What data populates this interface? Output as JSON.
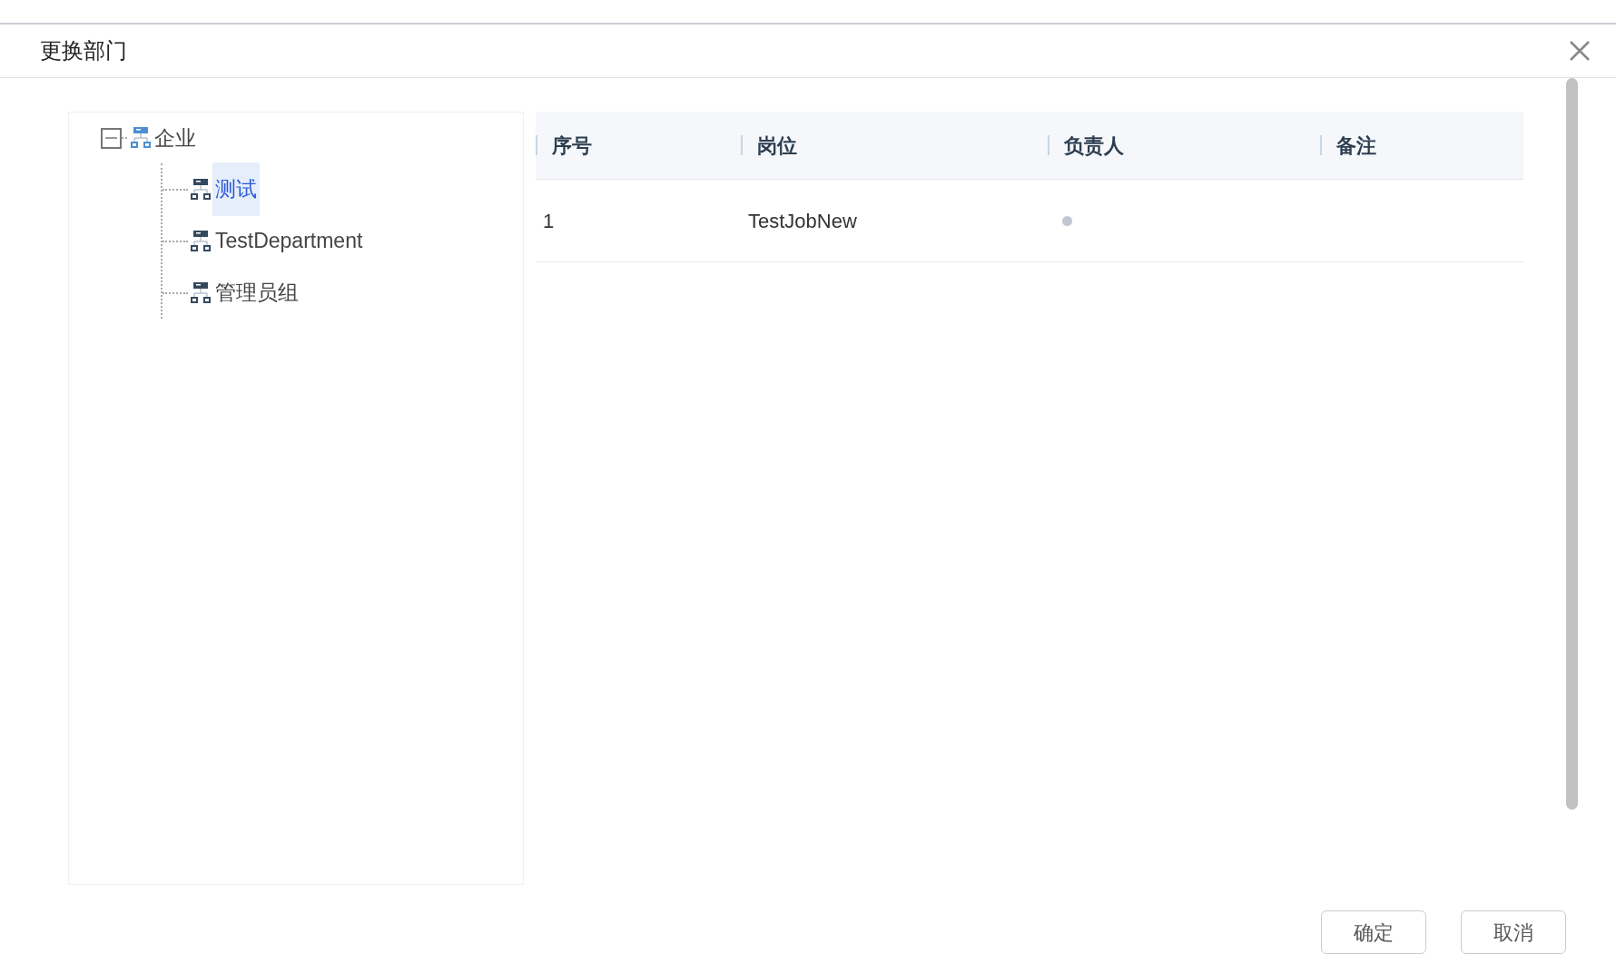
{
  "dialog": {
    "title": "更换部门"
  },
  "tree": [
    {
      "label": "企业",
      "expanded": true,
      "selected": false,
      "children": [
        {
          "label": "测试",
          "selected": true
        },
        {
          "label": "TestDepartment",
          "selected": false
        },
        {
          "label": "管理员组",
          "selected": false
        }
      ]
    }
  ],
  "table": {
    "columns": [
      "序号",
      "岗位",
      "负责人",
      "备注"
    ],
    "rows": [
      {
        "cells": [
          "1",
          "TestJobNew",
          ""
        ],
        "has_dot": true
      }
    ]
  },
  "buttons": [
    "确定",
    "取消"
  ]
}
